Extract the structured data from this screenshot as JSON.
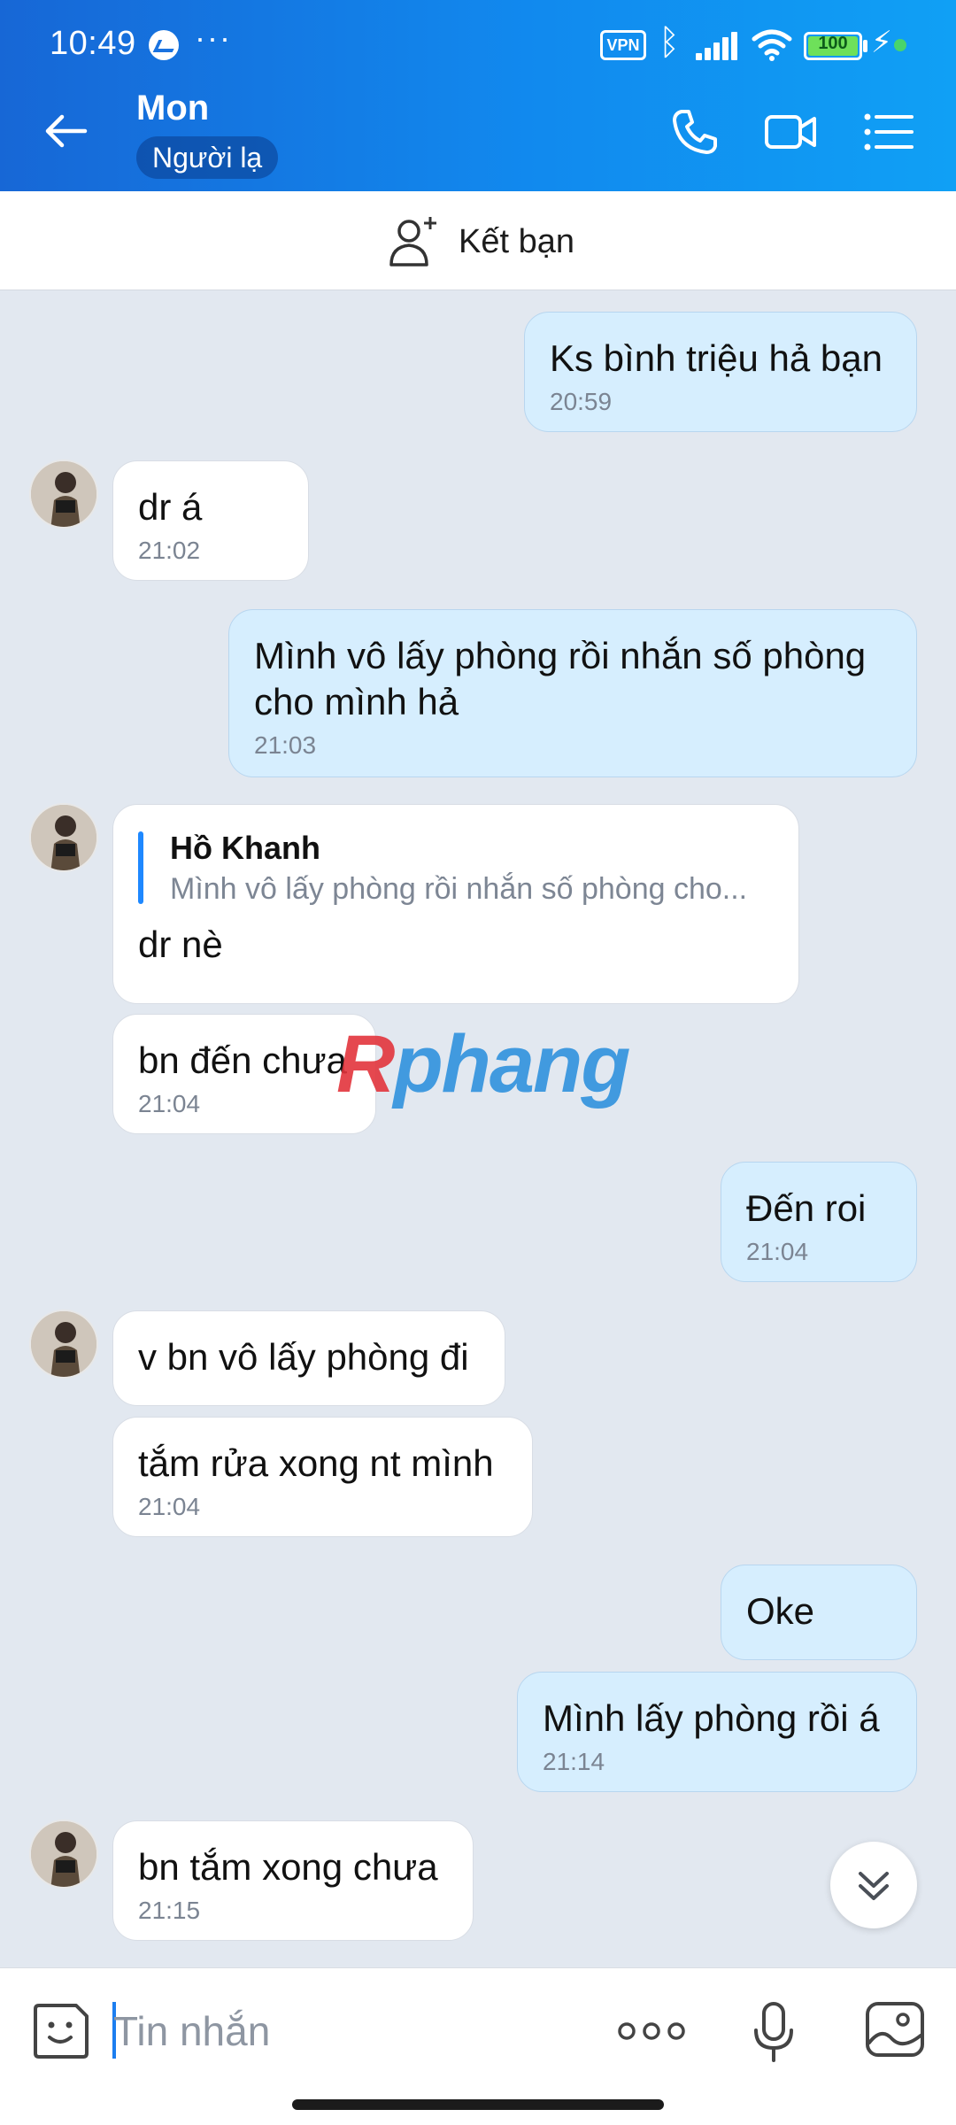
{
  "status_bar": {
    "time": "10:49",
    "more": "···",
    "vpn": "VPN",
    "battery": "100",
    "battery_level": 1.0
  },
  "header": {
    "name": "Mon",
    "badge": "Người lạ"
  },
  "add_friend": {
    "label": "Kết bạn"
  },
  "messages": [
    {
      "text": "Ks bình triệu hả bạn",
      "time": "20:59"
    },
    {
      "text": "dr á",
      "time": "21:02"
    },
    {
      "text": "Mình vô lấy phòng rồi nhắn số phòng\ncho mình hả",
      "time": "21:03"
    },
    {
      "reply_name": "Hồ Khanh",
      "reply_text": "Mình vô lấy phòng rồi nhắn số phòng cho...",
      "text": "dr nè"
    },
    {
      "text": "bn đến chưa",
      "time": "21:04"
    },
    {
      "text": "Đến roi",
      "time": "21:04"
    },
    {
      "text": "v bn vô lấy phòng đi"
    },
    {
      "text": "tắm rửa xong nt mình",
      "time": "21:04"
    },
    {
      "text": "Oke"
    },
    {
      "text": "Mình lấy phòng rồi á",
      "time": "21:14"
    },
    {
      "text": "bn tắm xong chưa",
      "time": "21:15"
    }
  ],
  "watermark": {
    "part1": "R",
    "part2": "phang"
  },
  "composer": {
    "placeholder": "Tin nhắn"
  },
  "colors": {
    "accent": "#1a8cf0",
    "incoming": "#ffffff",
    "outgoing": "#d6eefe",
    "background": "#e2e8f0"
  }
}
